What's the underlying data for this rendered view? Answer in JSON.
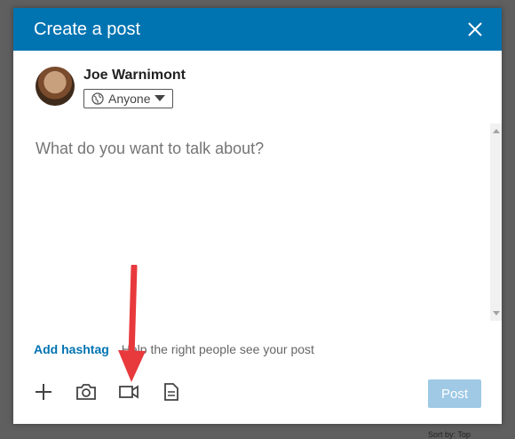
{
  "modal": {
    "title": "Create a post",
    "close_icon": "close-icon"
  },
  "author": {
    "name": "Joe Warnimont",
    "audience": "Anyone",
    "audience_icon": "globe-icon",
    "dropdown_icon": "caret-down-icon"
  },
  "editor": {
    "placeholder": "What do you want to talk about?"
  },
  "hashtag": {
    "label": "Add hashtag",
    "help": "Help the right people see your post"
  },
  "toolbar": {
    "icons": [
      "plus-icon",
      "camera-icon",
      "video-icon",
      "document-icon"
    ]
  },
  "post_button": {
    "label": "Post"
  },
  "footer": {
    "sort_text": "Sort by: Top"
  },
  "colors": {
    "header": "#0073b1",
    "link": "#0073b1",
    "post_disabled": "#9fc9e5",
    "arrow": "#e8393c"
  }
}
